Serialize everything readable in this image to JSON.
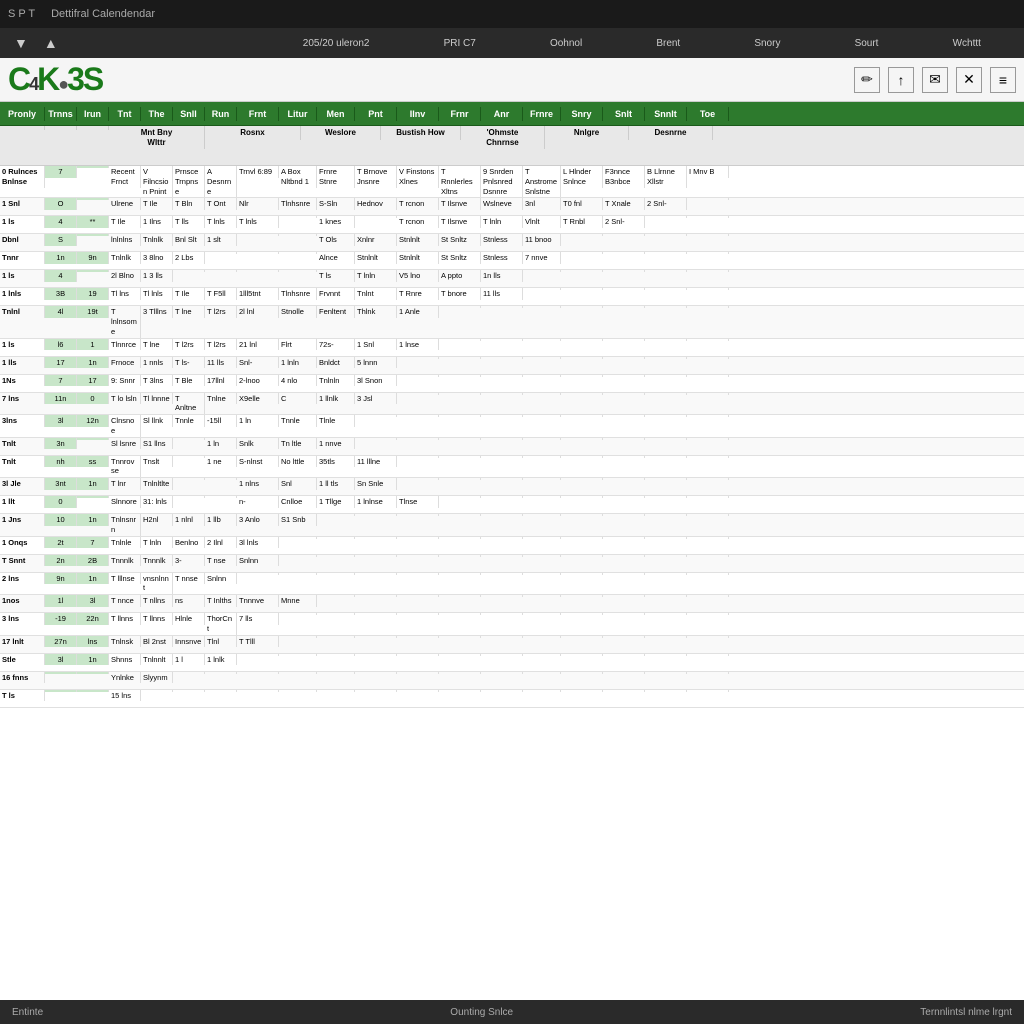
{
  "titleBar": {
    "appName": "S P T",
    "title": "Dettifral Calendendar"
  },
  "menuBar": {
    "chevronDown": "▼",
    "chevronUp": "▲",
    "items": [
      "205/20 uleron2",
      "PRI C7",
      "Oohnol",
      "Brent",
      "Snory",
      "Sourt",
      "Wchttt"
    ]
  },
  "logoBar": {
    "logo": "C4K●3S",
    "toolbarIcons": [
      "✏",
      "↑",
      "✉",
      "✕",
      "≡"
    ]
  },
  "columnHeaders": [
    "Pronly",
    "Trnns",
    "Irun",
    "Tnt",
    "The",
    "Snll",
    "Run",
    "Frnt",
    "Litur",
    "Men",
    "Pnt",
    "Ilnv",
    "Frnr",
    "Anr",
    "Frnre",
    "Snry",
    "Snlt",
    "Snnlt"
  ],
  "subHeaders": [
    "Mn Bny Wlttr",
    "Rosnx",
    "Weslore",
    "Bustish How",
    "'Ohmste Chnrnse",
    "Nnlgre",
    "Desnrne"
  ],
  "tableRows": [
    [
      "0 Rulnces Bnlnse",
      "7",
      "",
      "Recent Frnct",
      "V Filncsion Pnint",
      "Prnsce Trnpnse",
      "A Desnrne",
      "Trnvl 6:89",
      "A Box Nltbnd 1",
      "Frnre Stnre",
      "T Brnove Jnsnre",
      "V Finstons Xlnes",
      "T Rnnlerles Xltns",
      "9 Snrden Pnlsnred Dsnnre",
      "T Anstrome Snlstne",
      "L Hlnder Snlnce",
      "F3nnce B3nbce",
      "B Llrnne Xllstr",
      "I Mnv B"
    ],
    [
      "1 Snl",
      "O",
      "",
      "Ulrene",
      "T Ile",
      "T Bln",
      "T Ont",
      "Nlr",
      "Tlnhsnre",
      "S-Sln",
      "Hednov",
      "T rcnon",
      "T Ilsnve",
      "Wslneve",
      "3nl",
      "T0 fnl",
      "T Xnale",
      "2 Snl-"
    ],
    [
      "1 ls",
      "4",
      "**",
      "T Ile",
      "1 Ilns",
      "T lls",
      "T lnls",
      "T lnls",
      "",
      "1 knes",
      "",
      "T rcnon",
      "T Ilsnve",
      "T lnln",
      "Vlnlt",
      "T Rnbl",
      "2 Snl-"
    ],
    [
      "Dbnl",
      "S",
      "",
      "lnlnlns",
      "Tnlnlk",
      "Bnl Slt",
      "1 slt",
      "",
      "",
      "T Ols",
      "Xnlnr",
      "Stnlnlt",
      "St Snltz",
      "Stnless",
      "11 bnoo"
    ],
    [
      "Tnnr",
      "1n",
      "9n",
      "Tnlnlk",
      "3 8lno",
      "2 Lbs",
      "",
      "",
      "",
      "Alnce",
      "Stnlnlt",
      "Stnlnlt",
      "St Snltz",
      "Stnless",
      "7 nnve"
    ],
    [
      "1 ls",
      "4",
      "",
      "2l Blno",
      "1 3 lls",
      "",
      "",
      "",
      "",
      "T ls",
      "T lnln",
      "V5 lno",
      "A ppto",
      "1n lls"
    ],
    [
      "1 lnls",
      "3B",
      "19",
      "Tl lns",
      "Tl lnls",
      "T Ile",
      "T F5ll",
      "1lll5tnt",
      "Tlnhsnre",
      "Frvnnt",
      "Tnlnt",
      "T Rnre",
      "T bnore",
      "11 lls"
    ],
    [
      "Tnlnl",
      "4l",
      "19t",
      "T lnlnsome",
      "3 Tlllns",
      "T lne",
      "T l2rs",
      "2l lnl",
      "Stnolle",
      "Fenltent",
      "Thlnk",
      "1 Anle"
    ],
    [
      "1 ls",
      "l6",
      "1",
      "Tlnnrce",
      "T lne",
      "T l2rs",
      "T l2rs",
      "21 lnl",
      "Flrt",
      "72s-",
      "1 Snl",
      "1 lnse"
    ],
    [
      "1 lls",
      "17",
      "1n",
      "Frnoce",
      "1 nnls",
      "T ls-",
      "11 lls",
      "Snl-",
      "1 lnln",
      "Bnldct",
      "5 lnnn"
    ],
    [
      "1Ns",
      "7",
      "17",
      "9: Snnr",
      "T 3lns",
      "T Ble",
      "17llnl",
      "2-lnoo",
      "4 nlo",
      "Tnlnln",
      "3l Snon"
    ],
    [
      "7 lns",
      "11n",
      "0",
      "T lo lsln",
      "Tl lnnne",
      "T Anltne",
      "Tnlne",
      "X9elle",
      "C",
      "1 llnlk",
      "3 Jsl"
    ],
    [
      "3lns",
      "3l",
      "12n",
      "Clnsnoe",
      "Sl llnk",
      "Tnnle",
      "-15ll",
      "1 ln",
      "Tnnle",
      "Tlnle"
    ],
    [
      "Tnlt",
      "3n",
      "",
      "Sl lsnre",
      "S1 llns",
      "",
      "1 ln",
      "Snlk",
      "Tn ltle",
      "1 nnve"
    ],
    [
      "Tnlt",
      "nh",
      "ss",
      "Tnnrovse",
      "Tnslt",
      "",
      "1 ne",
      "S-nlnst",
      "No lttle",
      "35tls",
      "11 lllne"
    ],
    [
      "3l Jle",
      "3nt",
      "1n",
      "T lnr",
      "Tnlnltlte",
      "",
      "",
      "1 nlns",
      "Snl",
      "1 ll tls",
      "Sn Snle"
    ],
    [
      "1 llt",
      "0",
      "",
      "Slnnore",
      "31: lnls",
      "",
      "",
      "n-",
      "Cnlloe",
      "1 Tllge",
      "1 lnlnse",
      "Tlnse"
    ],
    [
      "1 Jns",
      "10",
      "1n",
      "Tnlnsnrn",
      "H2nl",
      "1 nlnl",
      "1 llb",
      "3 Anlo",
      "S1 Snb"
    ],
    [
      "1 Onqs",
      "2t",
      "7",
      "Tnlnle",
      "T lnln",
      "Benlno",
      "2 Ilnl",
      "3l lnls"
    ],
    [
      "T Snnt",
      "2n",
      "2B",
      "Tnnnlk",
      "Tnnnlk",
      "3-",
      "T nse",
      "Snlnn"
    ],
    [
      "2 lns",
      "9n",
      "1n",
      "T lllnse",
      "vnsnlnnt",
      "T nnse",
      "Snlnn"
    ],
    [
      "1nos",
      "1l",
      "3l",
      "T nnce",
      "T nllns",
      "ns",
      "T Inlths",
      "Tnnnve",
      "Mnne"
    ],
    [
      "3 lns",
      "-19",
      "22n",
      "T llnns",
      "T llnns",
      "Hlnle",
      "ThorCnt",
      "7 lls"
    ],
    [
      "17 lnlt",
      "27n",
      "lns",
      "Tnlnsk",
      "Bl 2nst",
      "Innsnve",
      "Tlnl",
      "T Tlll"
    ],
    [
      "Stle",
      "3l",
      "1n",
      "Shnns",
      "Tnlnnlt",
      "1 l",
      "1 lnlk"
    ],
    [
      "16 fnns",
      "",
      "",
      "Ynlnke",
      "Slyynm",
      ""
    ],
    [
      "T ls",
      "",
      "",
      "15 lns",
      ""
    ]
  ],
  "statusBar": {
    "left": "Entinte",
    "center": "Ounting Snlce",
    "right": "Ternnlintsl nlme lrgnt"
  }
}
